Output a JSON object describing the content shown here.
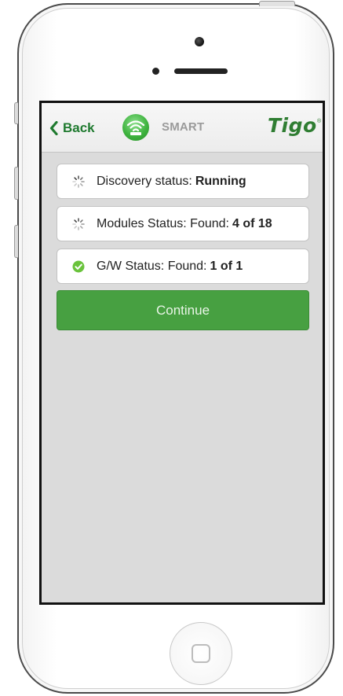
{
  "navbar": {
    "back_label": "Back",
    "mode_label": "SMART",
    "logo_text": "Tigo",
    "logo_mark": "®"
  },
  "statuses": [
    {
      "label": "Discovery status:",
      "value": "Running",
      "icon": "spinner-icon"
    },
    {
      "label": "Modules Status: Found:",
      "value": "4 of 18",
      "icon": "spinner-icon"
    },
    {
      "label": "G/W Status: Found:",
      "value": "1 of 1",
      "icon": "check-circle-icon"
    }
  ],
  "continue_label": "Continue",
  "colors": {
    "brand_green": "#2f7d32",
    "button_green": "#47a041",
    "check_green": "#6ac33c",
    "screen_bg": "#dbdbdb"
  }
}
